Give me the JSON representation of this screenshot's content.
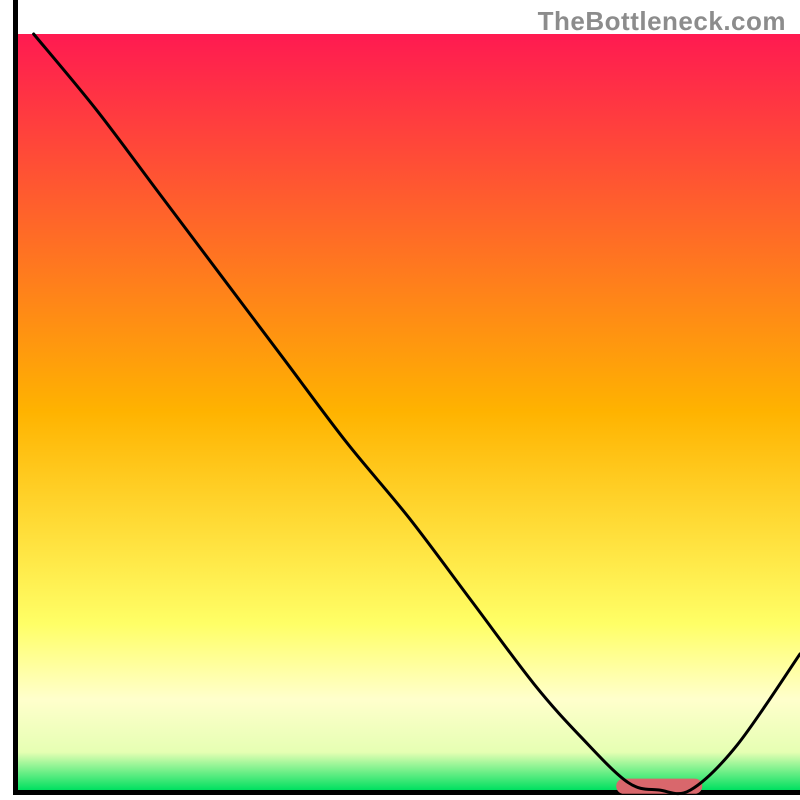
{
  "watermark": "TheBottleneck.com",
  "chart_data": {
    "type": "line",
    "title": "",
    "xlabel": "",
    "ylabel": "",
    "xlim": [
      0,
      100
    ],
    "ylim": [
      0,
      100
    ],
    "grid": false,
    "legend": false,
    "background_gradient": {
      "stops": [
        {
          "offset": 0.0,
          "color": "#ff1a51"
        },
        {
          "offset": 0.5,
          "color": "#ffb300"
        },
        {
          "offset": 0.78,
          "color": "#ffff66"
        },
        {
          "offset": 0.88,
          "color": "#ffffcc"
        },
        {
          "offset": 0.95,
          "color": "#e6ffb3"
        },
        {
          "offset": 1.0,
          "color": "#00e060"
        }
      ]
    },
    "series": [
      {
        "name": "curve",
        "x": [
          2,
          10,
          18,
          26,
          34,
          42,
          50,
          58,
          66,
          72,
          78,
          82,
          86,
          92,
          100
        ],
        "y": [
          100,
          90,
          79,
          68,
          57,
          46,
          36,
          25,
          14,
          7,
          1,
          0,
          0,
          6,
          18
        ],
        "stroke": "#000000",
        "stroke_width": 3,
        "fill": "none"
      }
    ],
    "markers": [
      {
        "name": "bottleneck-marker",
        "shape": "rounded-rect",
        "x_center": 82,
        "y_center": 0.5,
        "width": 11,
        "height": 2,
        "fill": "#d9676c"
      }
    ],
    "axes": {
      "show_x_axis": true,
      "show_y_axis": true,
      "x_ticks": [],
      "y_ticks": [],
      "axis_color": "#000000",
      "axis_width": 5
    }
  }
}
